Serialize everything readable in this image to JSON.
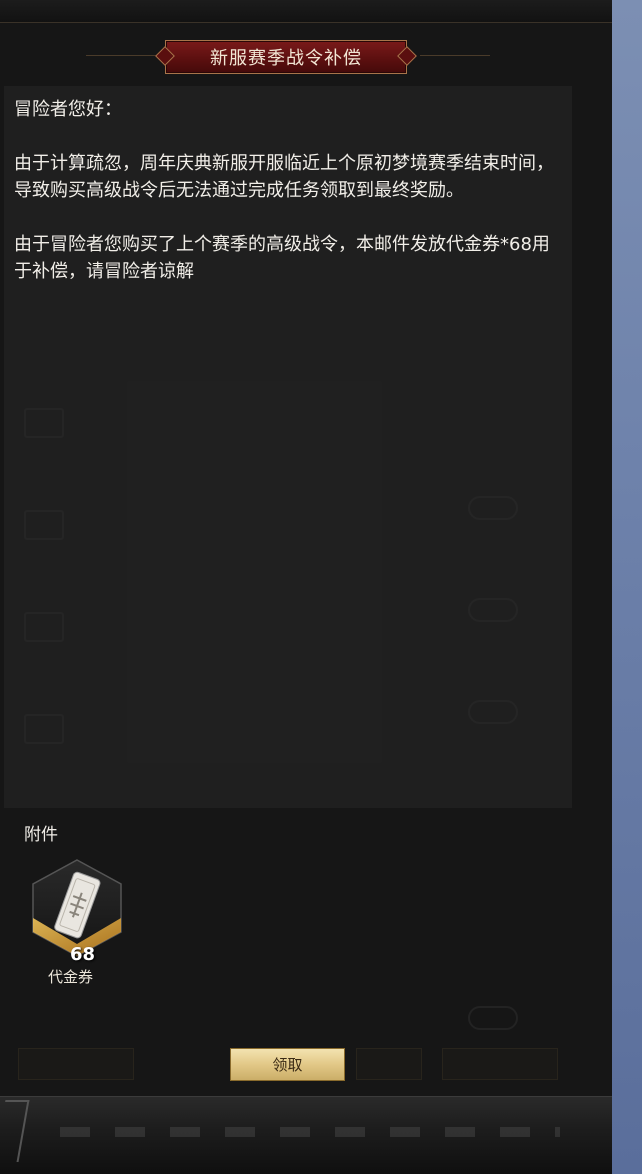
{
  "colors": {
    "title_banner": "#5a0f0f",
    "title_border": "#a8744a",
    "claim_button": "#e2c887",
    "side_strip": "#6e82ab",
    "item_frame_gold": "#d9a441"
  },
  "mail": {
    "title": "新服赛季战令补偿",
    "greeting": "冒险者您好：",
    "paragraph1": "由于计算疏忽，周年庆典新服开服临近上个原初梦境赛季结束时间，导致购买高级战令后无法通过完成任务领取到最终奖励。",
    "paragraph2": "由于冒险者您购买了上个赛季的高级战令，本邮件发放代金券*68用于补偿，请冒险者谅解"
  },
  "attachments": {
    "label": "附件",
    "items": [
      {
        "name": "代金券",
        "count": "68",
        "icon": "voucher-card-icon"
      }
    ]
  },
  "buttons": {
    "claim_label": "领取"
  }
}
